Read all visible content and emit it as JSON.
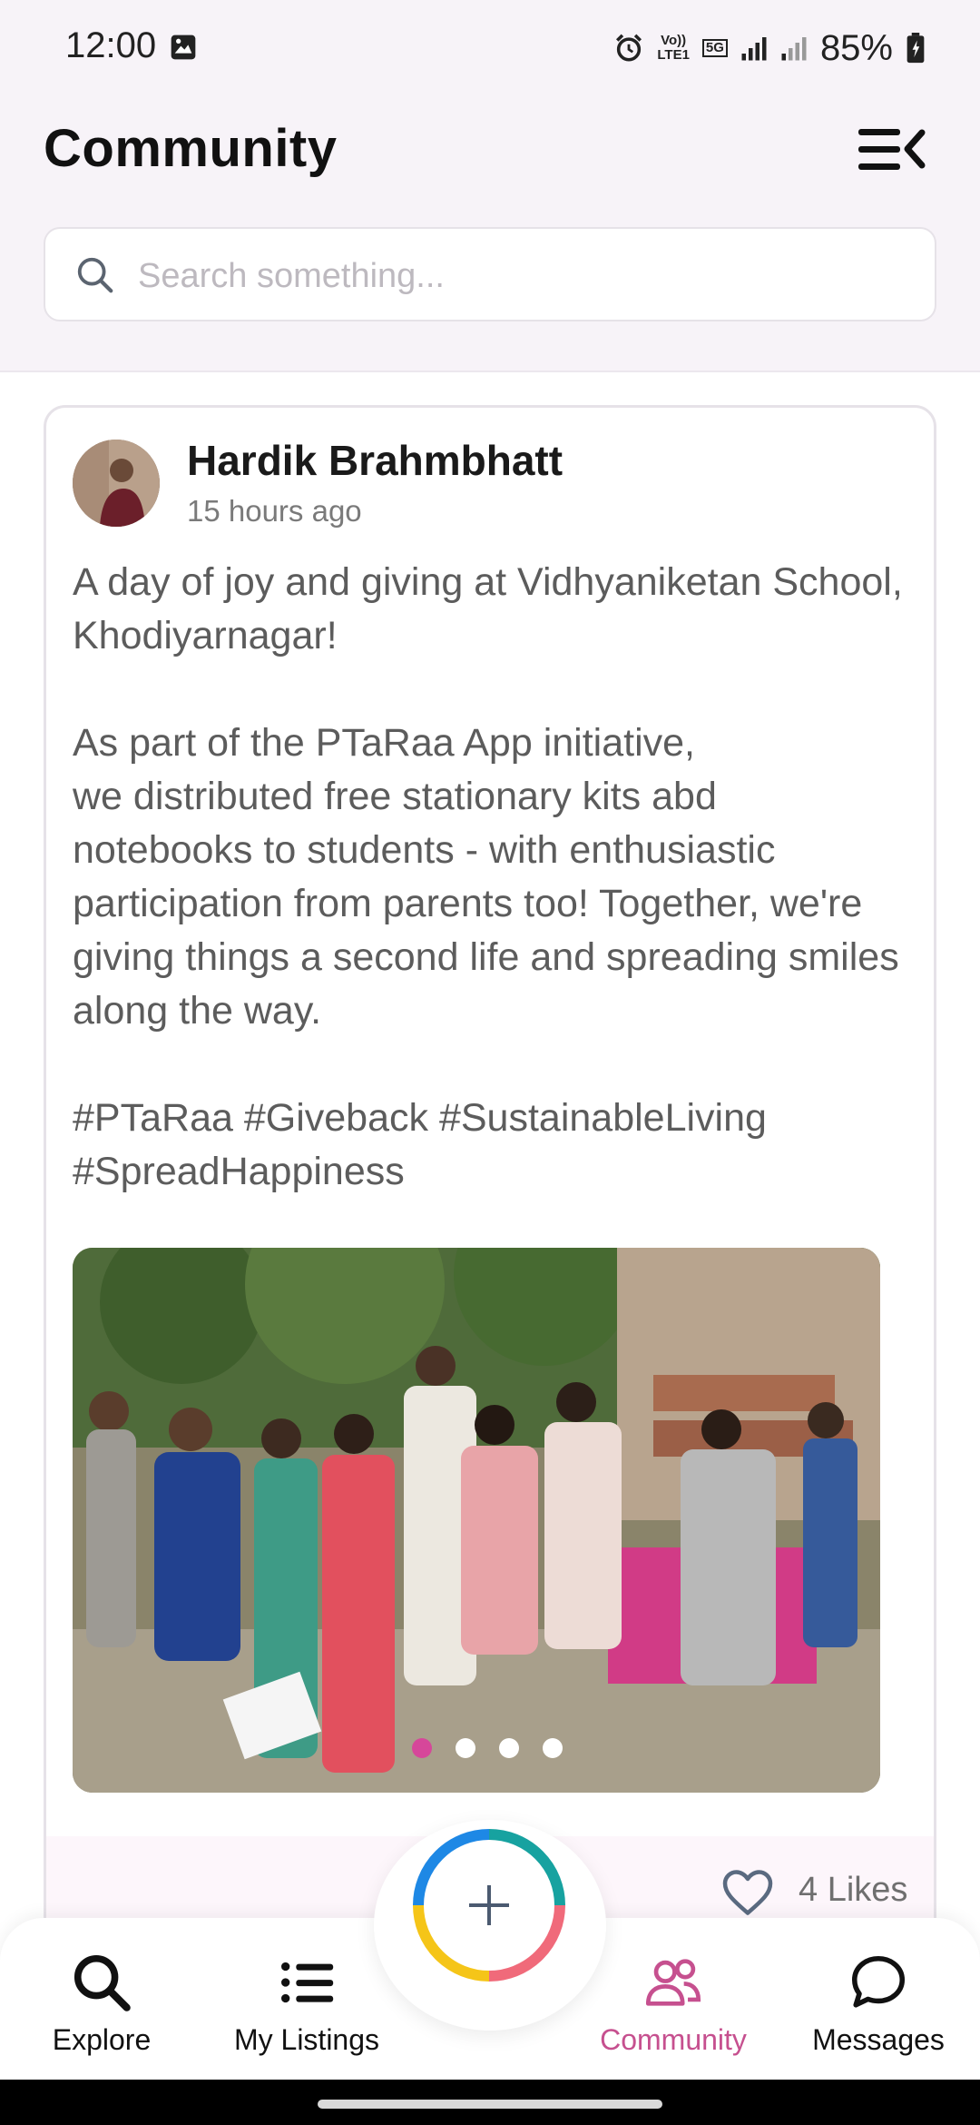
{
  "status_bar": {
    "time": "12:00",
    "battery": "85%",
    "network_volte": "Vo))\nLTE1",
    "network_5g": "5G"
  },
  "header": {
    "title": "Community"
  },
  "search": {
    "placeholder": "Search something..."
  },
  "post": {
    "author": "Hardik Brahmbhatt",
    "time_ago": "15 hours ago",
    "paragraphs": [
      "A day of joy and giving at Vidhyaniketan School, Khodiyarnagar!",
      "As part of the PTaRaa App initiative,\nwe distributed free stationary kits abd notebooks to students - with enthusiastic participation from parents too! Together, we're giving things a second life and spreading smiles along the way.",
      "#PTaRaa #Giveback #SustainableLiving #SpreadHappiness"
    ],
    "carousel": {
      "count": 4,
      "active_index": 0
    },
    "likes_label": "4 Likes"
  },
  "bottom_nav": {
    "items": [
      {
        "label": "Explore",
        "icon": "search-icon"
      },
      {
        "label": "My Listings",
        "icon": "list-icon"
      },
      {
        "label": "Community",
        "icon": "people-icon",
        "active": true
      },
      {
        "label": "Messages",
        "icon": "chat-bubble-icon"
      }
    ],
    "fab_icon": "plus-icon"
  },
  "colors": {
    "accent": "#c6508f",
    "header_bg": "#f7f3f8",
    "fab_ring": [
      "#1e88e5",
      "#17a2a0",
      "#f06a7a",
      "#f5c518"
    ]
  }
}
